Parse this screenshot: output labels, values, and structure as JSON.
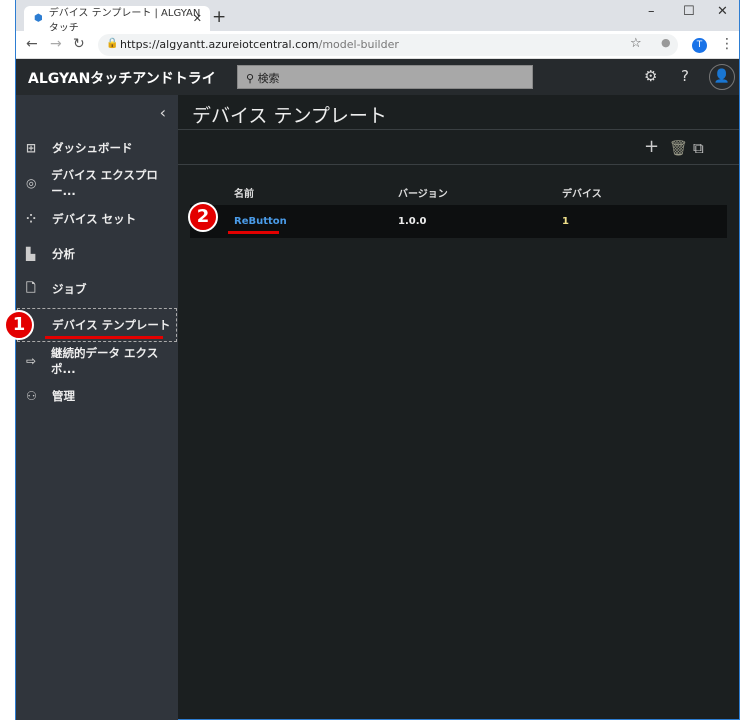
{
  "browser": {
    "tab_title": "デバイス テンプレート | ALGYANタッチ",
    "url_host": "https://algyantt.azureiotcentral.com",
    "url_path": "/model-builder",
    "profile_initial": "T"
  },
  "app": {
    "brand": "ALGYANタッチアンドトライ",
    "search_placeholder": "検索"
  },
  "sidebar": {
    "items": [
      {
        "label": "ダッシュボード",
        "icon": "dashboard-icon"
      },
      {
        "label": "デバイス エクスプロー...",
        "icon": "explorer-icon"
      },
      {
        "label": "デバイス セット",
        "icon": "device-set-icon"
      },
      {
        "label": "分析",
        "icon": "analytics-icon"
      },
      {
        "label": "ジョブ",
        "icon": "jobs-icon"
      },
      {
        "label": "デバイス テンプレート",
        "icon": "template-icon",
        "active": true
      },
      {
        "label": "継続的データ エクスポ...",
        "icon": "export-icon"
      },
      {
        "label": "管理",
        "icon": "admin-icon"
      }
    ]
  },
  "main": {
    "title": "デバイス テンプレート",
    "columns": [
      "名前",
      "バージョン",
      "デバイス"
    ],
    "rows": [
      {
        "name": "ReButton",
        "version": "1.0.0",
        "devices": "1"
      }
    ]
  },
  "annotations": {
    "step1": "1",
    "step2": "2",
    "color": "#e30000"
  }
}
